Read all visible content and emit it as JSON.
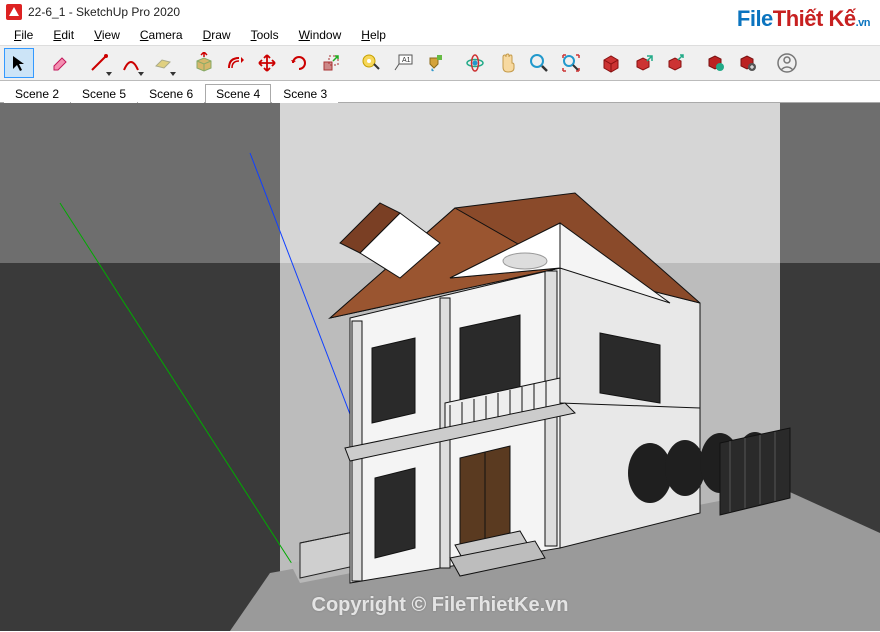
{
  "titlebar": {
    "title": "22-6_1 - SketchUp Pro 2020"
  },
  "watermark": {
    "file": "File",
    "thiet": "Thiết Kế",
    "vn": ".vn"
  },
  "menu": {
    "file": "File",
    "edit": "Edit",
    "view": "View",
    "camera": "Camera",
    "draw": "Draw",
    "tools": "Tools",
    "window": "Window",
    "help": "Help"
  },
  "scenes": {
    "items": [
      {
        "label": "Scene 2"
      },
      {
        "label": "Scene 5"
      },
      {
        "label": "Scene 6"
      },
      {
        "label": "Scene 4"
      },
      {
        "label": "Scene 3"
      }
    ],
    "active_index": 3
  },
  "copyright": "Copyright © FileThietKe.vn",
  "tools": {
    "select": "select",
    "eraser": "eraser",
    "line": "line",
    "arc": "arc",
    "shape": "rectangle",
    "pushpull": "pushpull",
    "offset": "offset",
    "move": "move",
    "rotate": "rotate",
    "scale": "scale",
    "tape": "tape",
    "text": "text",
    "paint": "paint",
    "orbit": "orbit",
    "pan": "pan",
    "zoom": "zoom",
    "zoomext": "zoom-extents",
    "wh3d": "3dwarehouse",
    "whget": "warehouse-get",
    "whsend": "warehouse-send",
    "ext": "extension",
    "extmgr": "extmgr",
    "user": "user"
  }
}
